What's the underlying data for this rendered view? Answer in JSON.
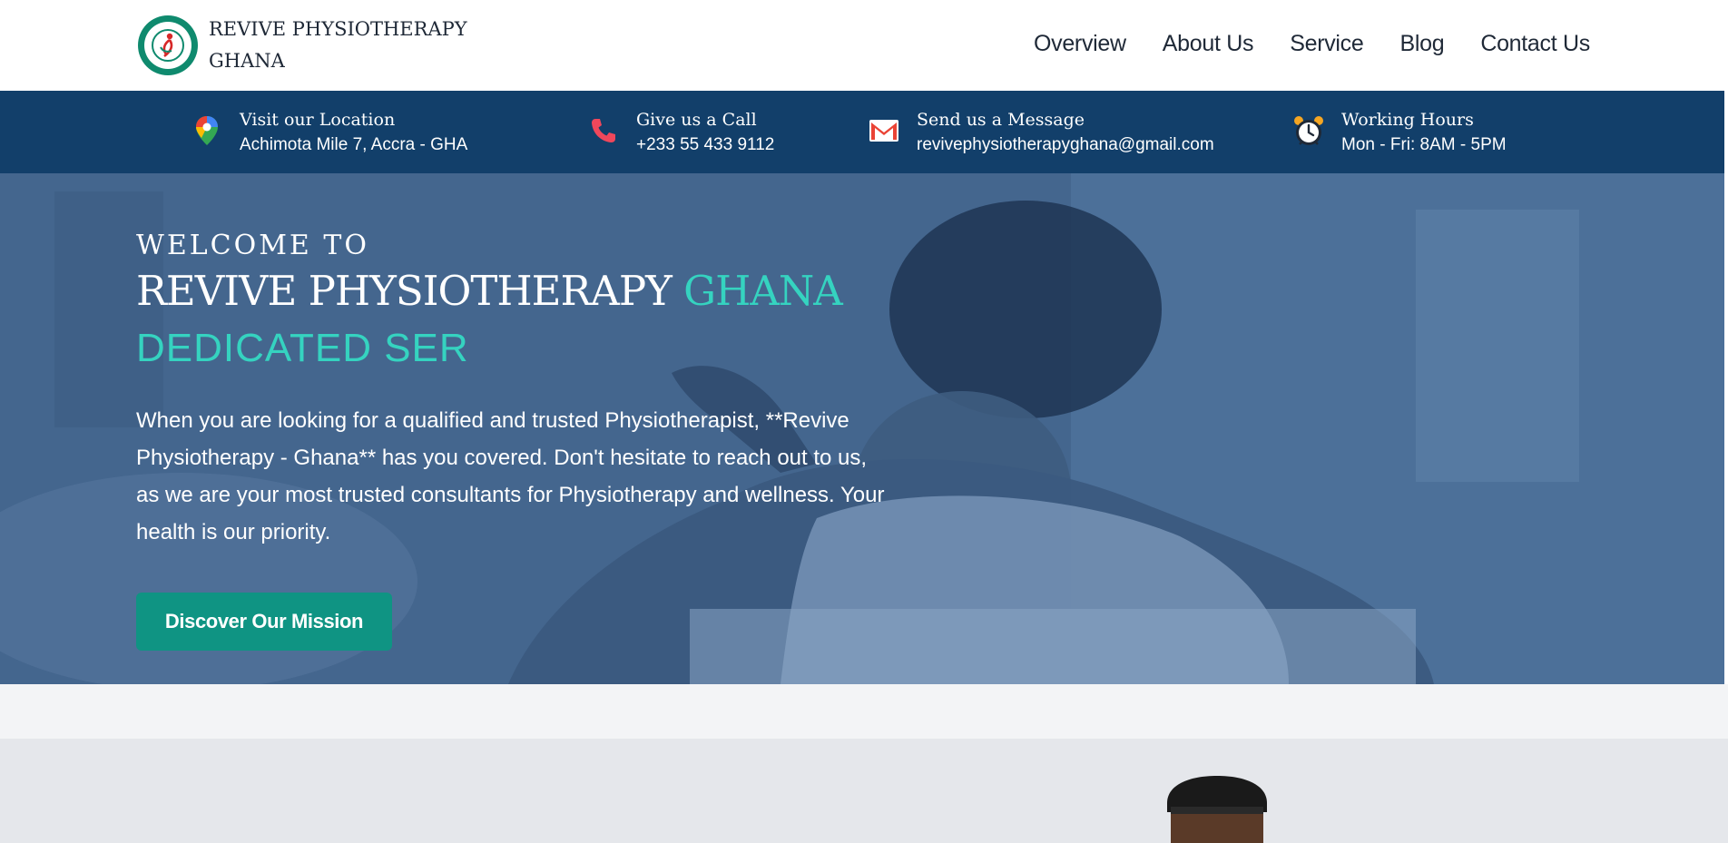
{
  "header": {
    "brand": "REVIVE PHYSIOTHERAPY GHANA",
    "brand_line1": "REVIVE PHYSIOTHERAPY",
    "brand_line2": "GHANA",
    "nav": [
      "Overview",
      "About Us",
      "Service",
      "Blog",
      "Contact Us"
    ]
  },
  "infobar": {
    "location": {
      "icon": "map-pin-icon",
      "title": "Visit our Location",
      "value": "Achimota Mile 7, Accra - GHA"
    },
    "phone": {
      "icon": "phone-icon",
      "title": "Give us a Call",
      "value": "+233 55 433 9112"
    },
    "email": {
      "icon": "mail-icon",
      "title": "Send us a Message",
      "value": "revivephysiotherapyghana@gmail.com"
    },
    "hours": {
      "icon": "alarm-clock-icon",
      "title": "Working Hours",
      "value": "Mon - Fri: 8AM - 5PM"
    }
  },
  "hero": {
    "welcome": "WELCOME TO",
    "title_main": "REVIVE PHYSIOTHERAPY",
    "title_accent": "GHANA",
    "typed_text": "DEDICATED SER",
    "description": "When you are looking for a qualified and trusted Physiotherapist, **Revive Physiotherapy - Ghana** has you covered. Don't hesitate to reach out to us, as we are your most trusted consultants for Physiotherapy and wellness. Your health is our priority.",
    "cta_label": "Discover Our Mission"
  },
  "colors": {
    "accent": "#35d3c0",
    "button": "#0f9483",
    "infobar": "#123f6a",
    "hero_overlay": "#47698f"
  }
}
